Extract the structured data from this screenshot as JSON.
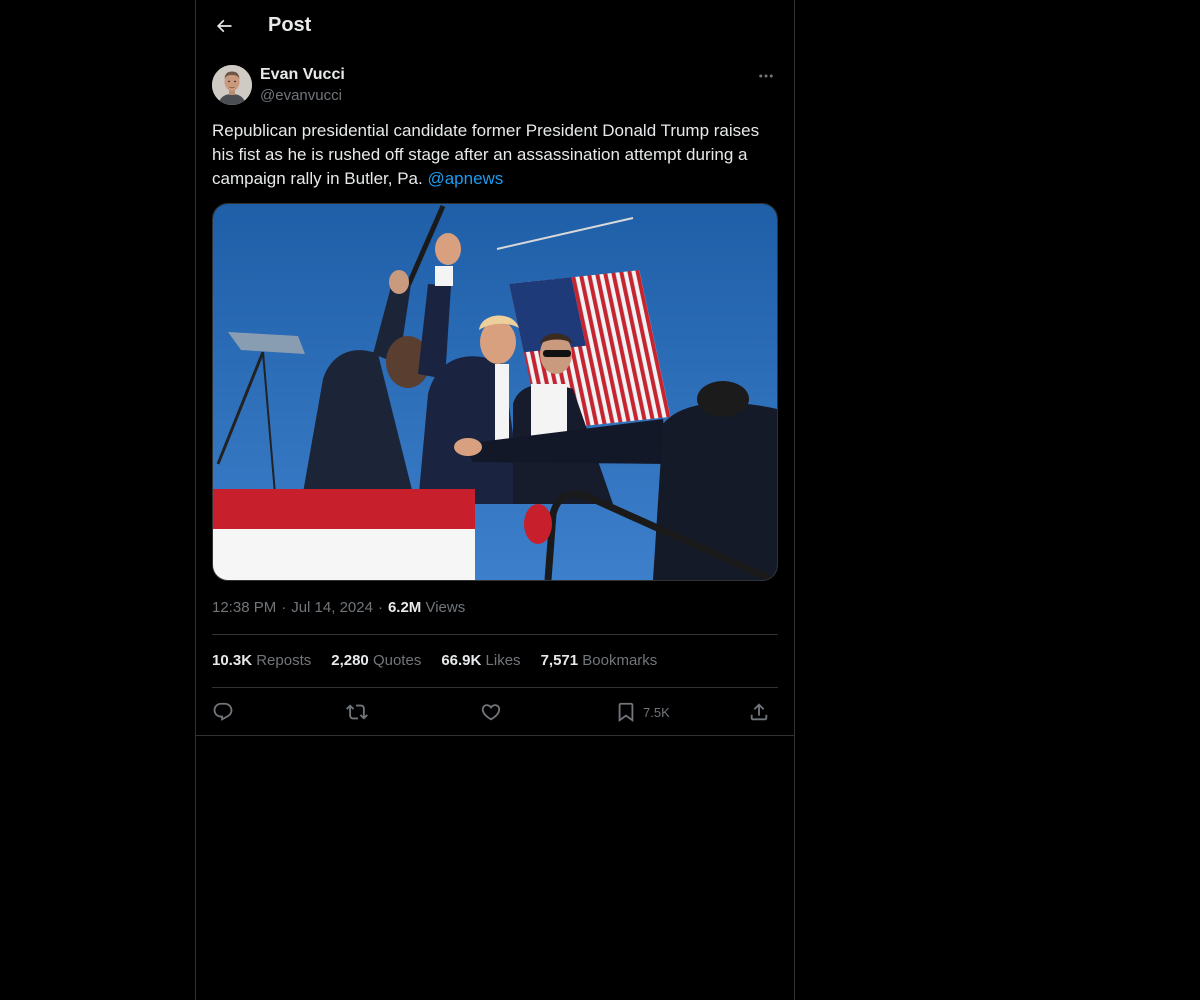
{
  "header": {
    "title": "Post",
    "back_icon": "arrow-left-icon"
  },
  "post": {
    "author": {
      "name": "Evan Vucci",
      "handle": "@evanvucci"
    },
    "more_icon": "more-horizontal-icon",
    "text": "Republican presidential candidate former President Donald Trump raises his fist as he is rushed off stage  after an assassination attempt during a campaign rally in Butler, Pa. ",
    "mention": "@apnews",
    "time": "12:38 PM",
    "date": "Jul 14, 2024",
    "views_count": "6.2M",
    "views_label": "Views",
    "separator": "·"
  },
  "stats": [
    {
      "count": "10.3K",
      "label": "Reposts"
    },
    {
      "count": "2,280",
      "label": "Quotes"
    },
    {
      "count": "66.9K",
      "label": "Likes"
    },
    {
      "count": "7,571",
      "label": "Bookmarks"
    }
  ],
  "actions": {
    "reply_icon": "reply-icon",
    "repost_icon": "repost-icon",
    "like_icon": "heart-icon",
    "bookmark_icon": "bookmark-icon",
    "bookmark_count": "7.5K",
    "share_icon": "share-icon"
  },
  "colors": {
    "background": "#000000",
    "text": "#e7e9ea",
    "muted": "#71767b",
    "accent": "#1d9bf0",
    "border": "#2f3336"
  }
}
